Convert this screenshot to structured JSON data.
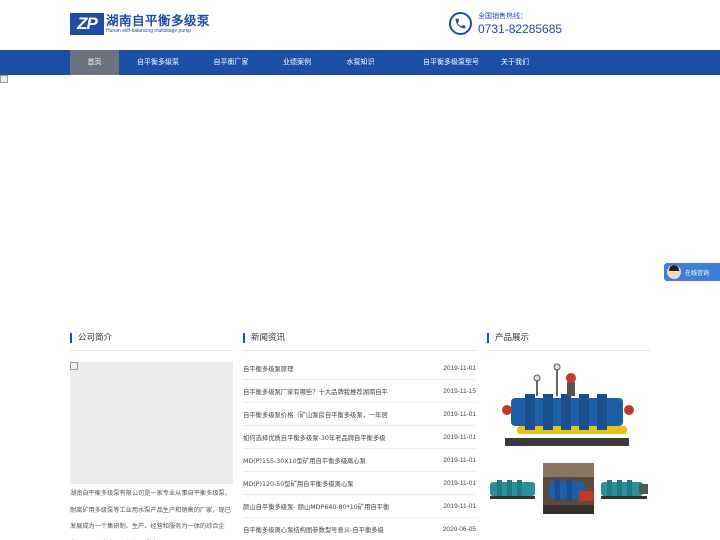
{
  "header": {
    "logo_mark": "ZP",
    "logo_cn": "湖南自平衡多级泵",
    "logo_en": "Hunan self-balancing multistage pump",
    "hotline_label": "全国销售热线：",
    "hotline_number": "0731-82285685"
  },
  "nav": {
    "items": [
      {
        "label": "首页",
        "active": true
      },
      {
        "label": "自平衡多级泵"
      },
      {
        "label": "自平衡厂家"
      },
      {
        "label": "业绩案例"
      },
      {
        "label": "水泵知识"
      },
      {
        "label": "自平衡多级泵型号"
      },
      {
        "label": "关于我们"
      }
    ]
  },
  "online_service": {
    "label": "在线咨询"
  },
  "about": {
    "title": "公司简介",
    "text": "湖南自平衡多级泵有限公司是一家专业从事自平衡多级泵，耐腐矿用多级泵等工业用水泵产品生产和销售的厂家，现已发展成为一个集研制、生产、经营和服务为一体的综合企业，公司已建立了一整套从设计"
  },
  "news": {
    "title": "新闻资讯",
    "items": [
      {
        "title": "自平衡多级泵原理",
        "date": "2019-11-01"
      },
      {
        "title": "自平衡多级泵厂家有哪些？十大品牌我推荐湖南自平",
        "date": "2019-11-15"
      },
      {
        "title": "自平衡多级泵价格（矿山泵房自平衡多级泵，一年居",
        "date": "2019-11-01"
      },
      {
        "title": "如何选择优质自平衡多级泵-30年老品牌自平衡多级",
        "date": "2019-11-01"
      },
      {
        "title": "MD(P)155-30X10型矿用自平衡多级离心泵",
        "date": "2019-11-01"
      },
      {
        "title": "MD(P)120-50型矿用自平衡多级离心泵",
        "date": "2019-11-01"
      },
      {
        "title": "颜山自平衡多级泵- 颜山MDP640-80*10矿用自平衡",
        "date": "2019-11-01"
      },
      {
        "title": "自平衡多级离心泵结构图参数型号意义-自平衡多级",
        "date": "2020-06-05"
      }
    ]
  },
  "products": {
    "title": "产品展示",
    "colors": {
      "pump_blue": "#1f5fa8",
      "pump_yellow": "#e8c21a",
      "pump_red": "#c0392b",
      "pump_teal": "#2a8f9a"
    }
  },
  "colors": {
    "brand": "#1d4fa6",
    "nav_active": "#6b7280",
    "online": "#3d7fd6"
  }
}
